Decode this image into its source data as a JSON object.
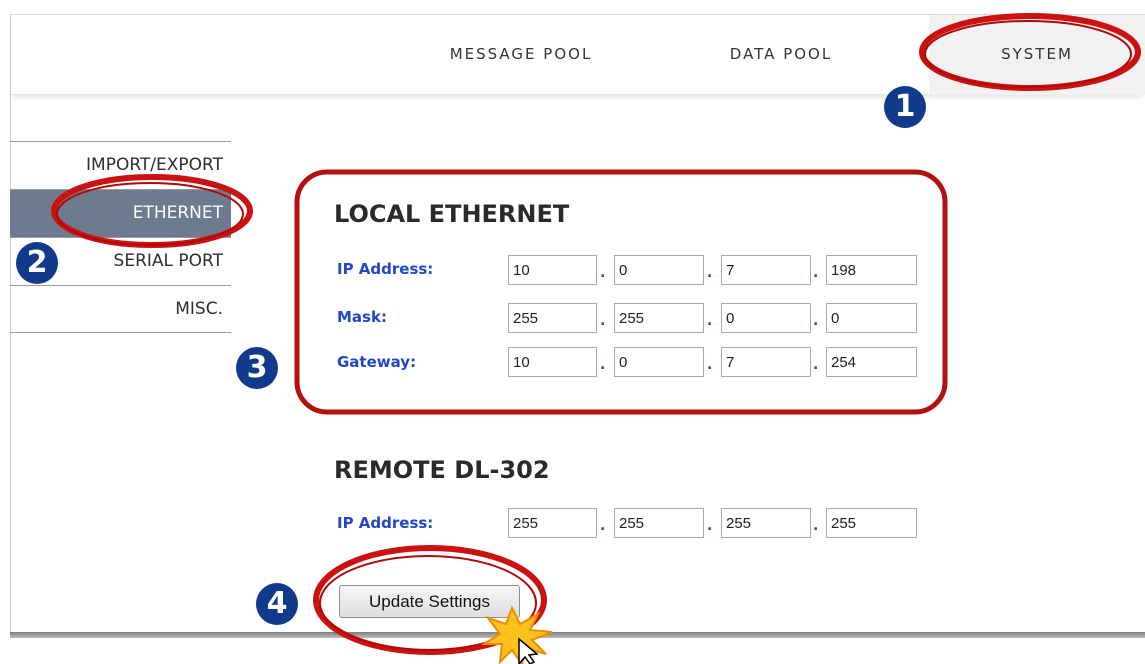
{
  "nav": {
    "message_pool": "MESSAGE POOL",
    "data_pool": "DATA POOL",
    "system": "SYSTEM"
  },
  "sidebar": {
    "items": [
      {
        "label": "IMPORT/EXPORT",
        "active": false
      },
      {
        "label": "ETHERNET",
        "active": true
      },
      {
        "label": "SERIAL PORT",
        "active": false
      },
      {
        "label": "MISC.",
        "active": false
      }
    ]
  },
  "local_ethernet": {
    "title": "LOCAL ETHERNET",
    "ip_label": "IP Address:",
    "ip": [
      "10",
      "0",
      "7",
      "198"
    ],
    "mask_label": "Mask:",
    "mask": [
      "255",
      "255",
      "0",
      "0"
    ],
    "gateway_label": "Gateway:",
    "gateway": [
      "10",
      "0",
      "7",
      "254"
    ]
  },
  "remote": {
    "title": "REMOTE DL-302",
    "ip_label": "IP Address:",
    "ip": [
      "255",
      "255",
      "255",
      "255"
    ]
  },
  "separator": ".",
  "buttons": {
    "update": "Update Settings"
  },
  "annotations": {
    "steps": [
      "1",
      "2",
      "3",
      "4"
    ],
    "badge_color": "#123a8c",
    "highlight_color": "#cc1111"
  },
  "colors": {
    "label_blue": "#1f48c8",
    "active_sidebar": "#6d7b8e"
  }
}
